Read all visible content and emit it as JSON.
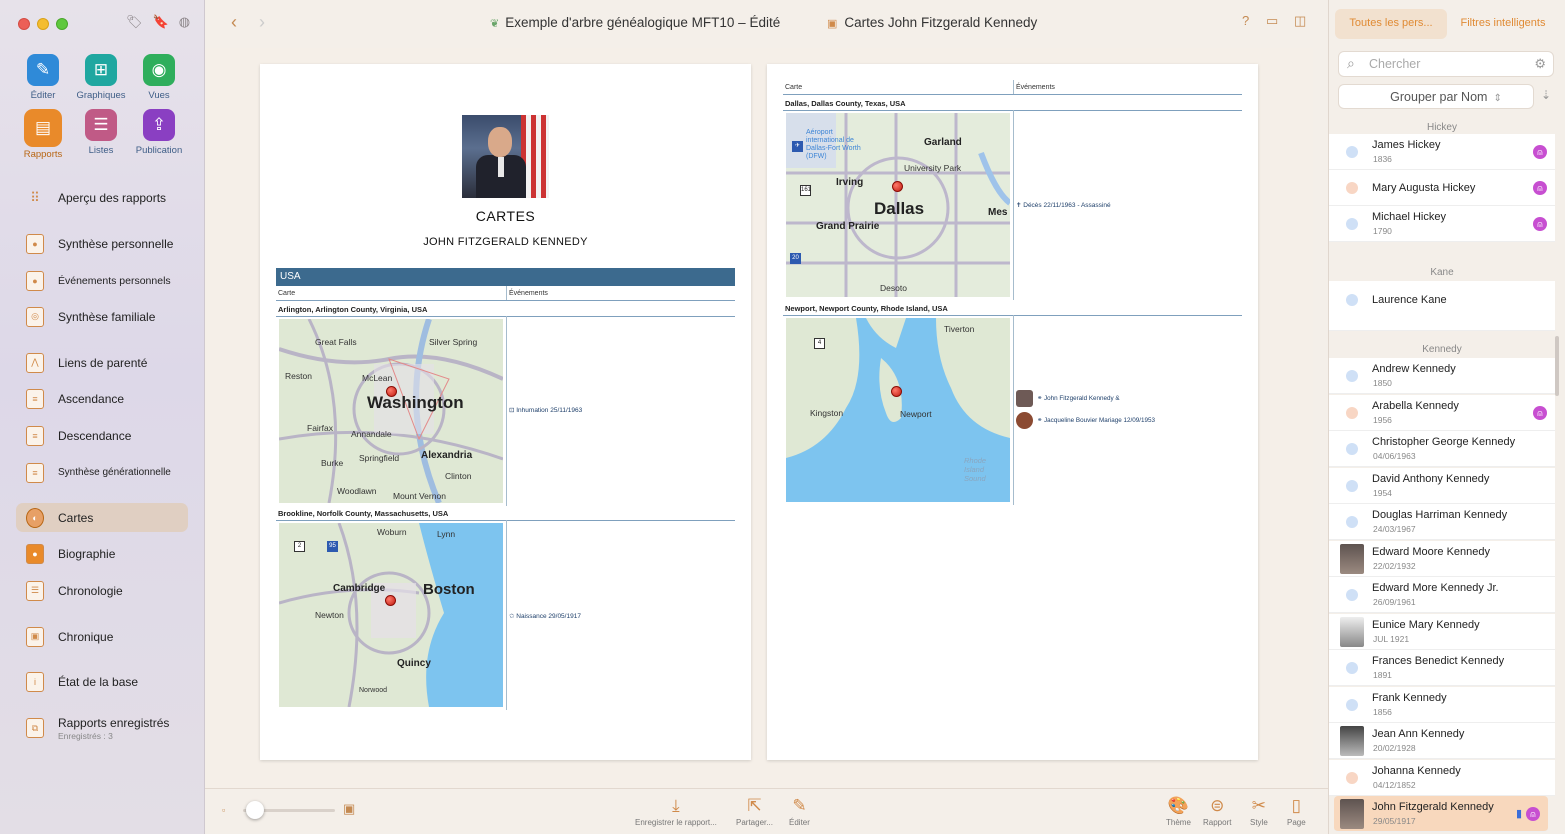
{
  "window": {
    "title": "Exemple d'arbre généalogique MFT10 – Édité",
    "document": "Cartes John Fitzgerald Kennedy"
  },
  "tools": [
    {
      "label": "Éditer",
      "icon": "pencil-icon",
      "color": "#2f8ad8"
    },
    {
      "label": "Graphiques",
      "icon": "tree-chart-icon",
      "color": "#1fa7a0"
    },
    {
      "label": "Vues",
      "icon": "eye-icon",
      "color": "#2fae5c"
    },
    {
      "label": "Rapports",
      "icon": "report-icon",
      "color": "#e98a2a"
    },
    {
      "label": "Listes",
      "icon": "list-icon",
      "color": "#c05a86"
    },
    {
      "label": "Publication",
      "icon": "upload-icon",
      "color": "#8a3fc2"
    }
  ],
  "nav": [
    {
      "label": "Aperçu des rapports",
      "icon": "grid-icon"
    },
    {
      "label": "Synthèse personnelle",
      "icon": "person-report-icon"
    },
    {
      "label": "Événements personnels",
      "icon": "person-events-icon"
    },
    {
      "label": "Synthèse familiale",
      "icon": "family-report-icon"
    },
    {
      "label": "Liens de parenté",
      "icon": "relationship-icon"
    },
    {
      "label": "Ascendance",
      "icon": "ancestors-icon"
    },
    {
      "label": "Descendance",
      "icon": "descendants-icon"
    },
    {
      "label": "Synthèse générationnelle",
      "icon": "generations-icon"
    },
    {
      "label": "Cartes",
      "icon": "globe-icon"
    },
    {
      "label": "Biographie",
      "icon": "biography-icon"
    },
    {
      "label": "Chronologie",
      "icon": "timeline-icon"
    },
    {
      "label": "Chronique",
      "icon": "chronicle-icon"
    },
    {
      "label": "État de la base",
      "icon": "info-icon"
    },
    {
      "label": "Rapports enregistrés",
      "sub": "Enregistrés : 3",
      "icon": "saved-reports-icon"
    }
  ],
  "report": {
    "title": "CARTES",
    "person": "JOHN FITZGERALD KENNEDY",
    "country": "USA",
    "col_map": "Carte",
    "col_events": "Événements",
    "locations": [
      {
        "place": "Arlington, Arlington County, Virginia, USA",
        "event": "⊡ Inhumation 25/11/1963",
        "labels": [
          "Great Falls",
          "Silver Spring",
          "Reston",
          "McLean",
          "Washington",
          "Fairfax",
          "Annandale",
          "Burke",
          "Springfield",
          "Alexandria",
          "Clinton",
          "Woodlawn",
          "Mount Vernon"
        ]
      },
      {
        "place": "Brookline, Norfolk County, Massachusetts, USA",
        "event": "✩ Naissance 29/05/1917",
        "labels": [
          "Woburn",
          "Lynn",
          "Cambridge",
          "Boston",
          "Newton",
          "Quincy",
          "Norwood"
        ]
      },
      {
        "place": "Dallas, Dallas County, Texas, USA",
        "event": "✝ Décès 22/11/1963 - Assassiné",
        "labels": [
          "Aéroport international de Dallas-Fort Worth (DFW)",
          "Garland",
          "University Park",
          "Irving",
          "Dallas",
          "Mes",
          "Grand Prairie",
          "Desoto"
        ]
      },
      {
        "place": "Newport, Newport County, Rhode Island, USA",
        "event_line1": "⚭ John Fitzgerald Kennedy &",
        "event_line2": "⚭ Jacqueline Bouvier  Mariage 12/09/1953",
        "labels": [
          "Tiverton",
          "Kingston",
          "Newport",
          "Rhode Island Sound"
        ]
      }
    ]
  },
  "bottombar": {
    "save": "Enregistrer le rapport...",
    "share": "Partager...",
    "edit": "Éditer",
    "theme": "Thème",
    "report": "Rapport",
    "style": "Style",
    "page": "Page"
  },
  "rightpanel": {
    "tab_all": "Toutes les pers...",
    "tab_smart": "Filtres intelligents",
    "search_placeholder": "Chercher",
    "groupby": "Grouper par Nom",
    "groups": [
      {
        "name": "Hickey",
        "people": [
          {
            "name": "James Hickey",
            "date": "1836",
            "sex": "m",
            "badge": true
          },
          {
            "name": "Mary Augusta Hickey",
            "date": "",
            "sex": "f",
            "badge": true
          },
          {
            "name": "Michael Hickey",
            "date": "1790",
            "sex": "m",
            "badge": true
          }
        ]
      },
      {
        "name": "Kane",
        "people": [
          {
            "name": "Laurence Kane",
            "date": "",
            "sex": "m",
            "badge": false
          }
        ]
      },
      {
        "name": "Kennedy",
        "people": [
          {
            "name": "Andrew Kennedy",
            "date": "1850",
            "sex": "m",
            "badge": false
          },
          {
            "name": "Arabella Kennedy",
            "date": "1956",
            "sex": "f",
            "badge": true
          },
          {
            "name": "Christopher George Kennedy",
            "date": "04/06/1963",
            "sex": "m",
            "badge": false
          },
          {
            "name": "David Anthony Kennedy",
            "date": "1954",
            "sex": "m",
            "badge": false
          },
          {
            "name": "Douglas Harriman Kennedy",
            "date": "24/03/1967",
            "sex": "m",
            "badge": false
          },
          {
            "name": "Edward Moore Kennedy",
            "date": "22/02/1932",
            "sex": "m",
            "photo": true,
            "badge": false
          },
          {
            "name": "Edward More Kennedy Jr.",
            "date": "26/09/1961",
            "sex": "m",
            "badge": false
          },
          {
            "name": "Eunice Mary Kennedy",
            "date": "JUL 1921",
            "sex": "f",
            "photo": true,
            "badge": false
          },
          {
            "name": "Frances Benedict Kennedy",
            "date": "1891",
            "sex": "m",
            "badge": false
          },
          {
            "name": "Frank Kennedy",
            "date": "1856",
            "sex": "m",
            "badge": false
          },
          {
            "name": "Jean Ann Kennedy",
            "date": "20/02/1928",
            "sex": "f",
            "photo": true,
            "badge": false
          },
          {
            "name": "Johanna Kennedy",
            "date": "04/12/1852",
            "sex": "f",
            "badge": false
          },
          {
            "name": "John Fitzgerald Kennedy",
            "date": "29/05/1917",
            "sex": "m",
            "photo": true,
            "badge": true,
            "bookmark": true,
            "selected": true
          }
        ]
      }
    ]
  }
}
